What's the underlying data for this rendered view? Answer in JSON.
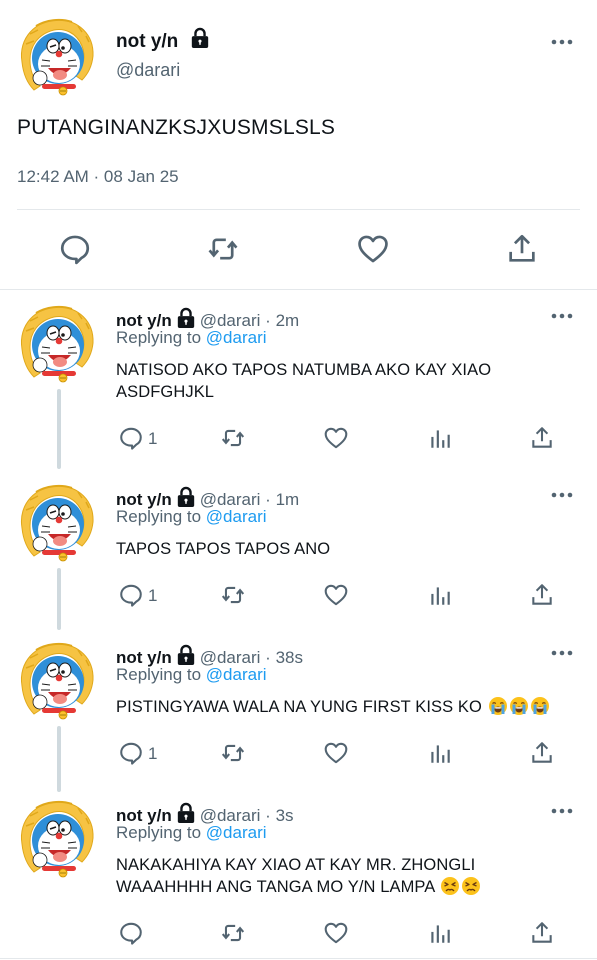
{
  "main_tweet": {
    "display_name": "not y/n",
    "handle": "@darari",
    "text": "PUTANGINANZKSJXUSMSLSLS",
    "timestamp": "12:42 AM · 08 Jan 25",
    "avatar_icon": "doraemon-avatar-icon",
    "locked_icon": "lock-icon"
  },
  "replies": [
    {
      "display_name": "not y/n",
      "handle": "@darari",
      "time_ago": "2m",
      "replying_prefix": "Replying to",
      "replying_to": "@darari",
      "lines": [
        "NATISOD AKO TAPOS NATUMBA AKO KAY XIAO",
        "ASDFGHJKL"
      ],
      "reply_count": "1"
    },
    {
      "display_name": "not y/n",
      "handle": "@darari",
      "time_ago": "1m",
      "replying_prefix": "Replying to",
      "replying_to": "@darari",
      "lines": [
        "TAPOS TAPOS TAPOS ANO"
      ],
      "reply_count": "1"
    },
    {
      "display_name": "not y/n",
      "handle": "@darari",
      "time_ago": "38s",
      "replying_prefix": "Replying to",
      "replying_to": "@darari",
      "lines": [
        "PISTINGYAWA WALA NA YUNG FIRST KISS KO"
      ],
      "emoji": [
        "loudly-crying-face",
        "loudly-crying-face",
        "loudly-crying-face"
      ],
      "reply_count": "1"
    },
    {
      "display_name": "not y/n",
      "handle": "@darari",
      "time_ago": "3s",
      "replying_prefix": "Replying to",
      "replying_to": "@darari",
      "lines": [
        "NAKAKAHIYA KAY XIAO AT KAY MR. ZHONGLI",
        "WAAAHHHH ANG TANGA MO Y/N LAMPA"
      ],
      "emoji": [
        "persevering-face",
        "persevering-face"
      ],
      "reply_count": ""
    }
  ],
  "colors": {
    "text": "#0f1419",
    "secondary": "#536471",
    "link": "#1d9bf0",
    "divider": "#e4e8eb",
    "thread_line": "#cfd9de"
  }
}
